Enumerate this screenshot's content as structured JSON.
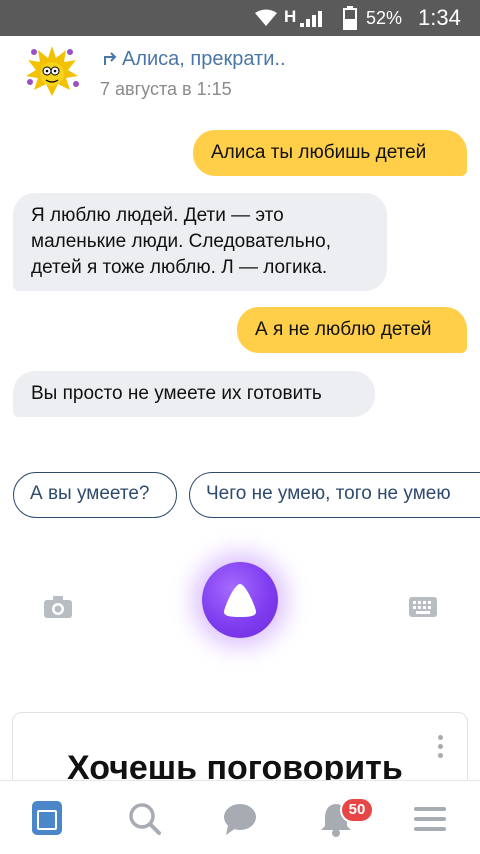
{
  "status_bar": {
    "network_label": "H",
    "battery_percent": "52%",
    "time": "1:34",
    "icons": [
      "wifi-icon",
      "signal-icon",
      "battery-icon"
    ]
  },
  "post": {
    "title": "Алиса, прекрати..",
    "date": "7 августа в 1:15"
  },
  "chat": {
    "messages": [
      {
        "from": "user",
        "text": "Алиса ты любишь детей"
      },
      {
        "from": "bot",
        "text": "Я люблю людей. Дети — это маленькие люди. Следовательно, детей я тоже люблю. Л — логика."
      },
      {
        "from": "user",
        "text": "А я не люблю детей"
      },
      {
        "from": "bot",
        "text": "Вы просто не умеете их готовить"
      }
    ],
    "suggestions": [
      "А вы умеете?",
      "Чего не умею, того не умею"
    ],
    "colors": {
      "user_bubble": "#ffcf4a",
      "bot_bubble": "#eceef1",
      "alice_button": "#7f3df0"
    }
  },
  "card": {
    "title": "Хочешь поговорить"
  },
  "bottom_nav": {
    "items": [
      "home-icon",
      "search-icon",
      "messages-icon",
      "notifications-icon",
      "menu-icon"
    ],
    "notifications_badge": "50"
  }
}
